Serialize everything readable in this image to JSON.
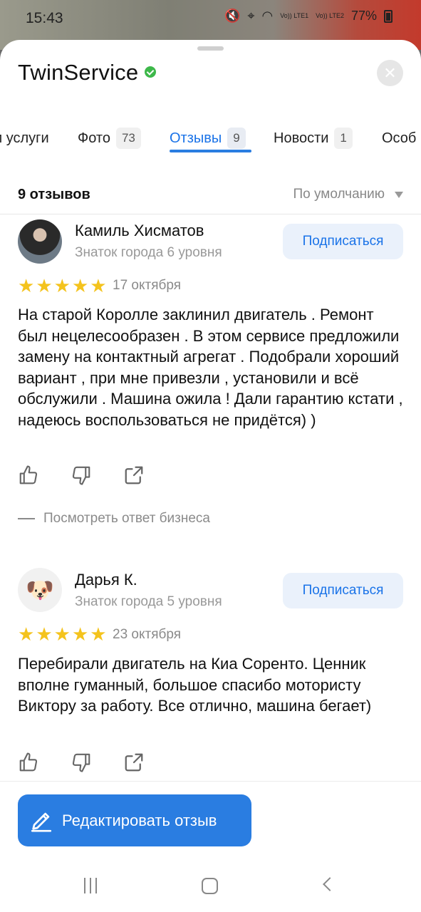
{
  "status": {
    "time": "15:43",
    "sim1": "Vo)) LTE1",
    "sim2": "Vo)) LTE2",
    "battery": "77%"
  },
  "header": {
    "title": "TwinService"
  },
  "tabs": [
    {
      "label": "и услуги",
      "count": ""
    },
    {
      "label": "Фото",
      "count": "73"
    },
    {
      "label": "Отзывы",
      "count": "9"
    },
    {
      "label": "Новости",
      "count": "1"
    },
    {
      "label": "Особ",
      "count": ""
    }
  ],
  "reviews": {
    "total_label": "9 отзывов",
    "sort_label": "По умолчанию",
    "items": [
      {
        "author": "Камиль Хисматов",
        "level": "Знаток города 6 уровня",
        "subscribe_label": "Подписаться",
        "rating": 5,
        "date": "17 октября",
        "text": "На старой Королле заклинил двигатель . Ремонт был нецелесообразен . В этом сервисе предложили замену на контактный агрегат . Подобрали хороший вариант , при мне привезли , установили и всё обслужили . Машина ожила ! Дали гарантию кстати , надеюсь воспользоваться не придётся) )",
        "answer_label": "Посмотреть ответ бизнеса"
      },
      {
        "author": "Дарья К.",
        "level": "Знаток города 5 уровня",
        "subscribe_label": "Подписаться",
        "rating": 5,
        "date": "23 октября",
        "text": "Перебирали двигатель на Киа Соренто. Ценник вполне гуманный, большое спасибо мотористу Виктору за работу. Все отлично, машина бегает)"
      }
    ]
  },
  "edit_button": {
    "label": "Редактировать отзыв"
  },
  "colors": {
    "accent": "#2a7de1",
    "star": "#f4c31d",
    "verified": "#3db84a"
  },
  "icons": [
    "like-icon",
    "dislike-icon",
    "share-icon",
    "pencil-icon",
    "close-icon",
    "verified-icon"
  ]
}
